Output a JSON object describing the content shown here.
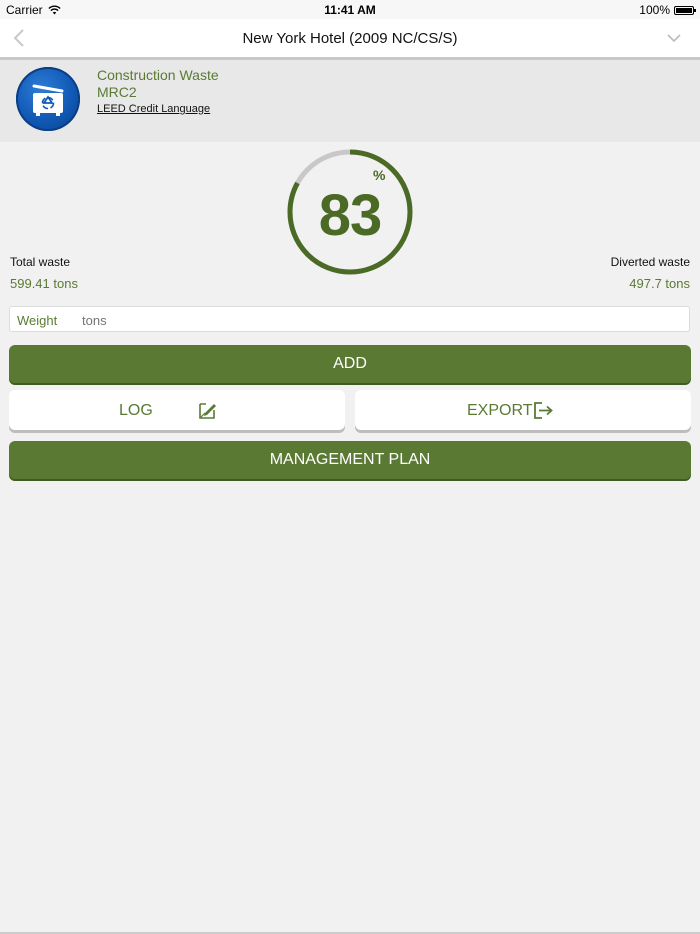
{
  "status_bar": {
    "carrier": "Carrier",
    "time": "11:41 AM",
    "battery": "100%"
  },
  "nav": {
    "title": "New York Hotel (2009 NC/CS/S)"
  },
  "credit": {
    "title": "Construction Waste",
    "code": "MRC2",
    "link": "LEED Credit Language"
  },
  "gauge": {
    "value": "83",
    "unit": "%",
    "percent": 83
  },
  "stats": {
    "total_label": "Total waste",
    "total_value": "599.41 tons",
    "diverted_label": "Diverted waste",
    "diverted_value": "497.7 tons"
  },
  "weight_field": {
    "label": "Weight",
    "placeholder": "tons"
  },
  "buttons": {
    "add": "ADD",
    "log": "LOG",
    "export": "EXPORT",
    "management_plan": "MANAGEMENT PLAN"
  },
  "colors": {
    "accent": "#5a7a34",
    "icon_blue": "#1059b5"
  }
}
